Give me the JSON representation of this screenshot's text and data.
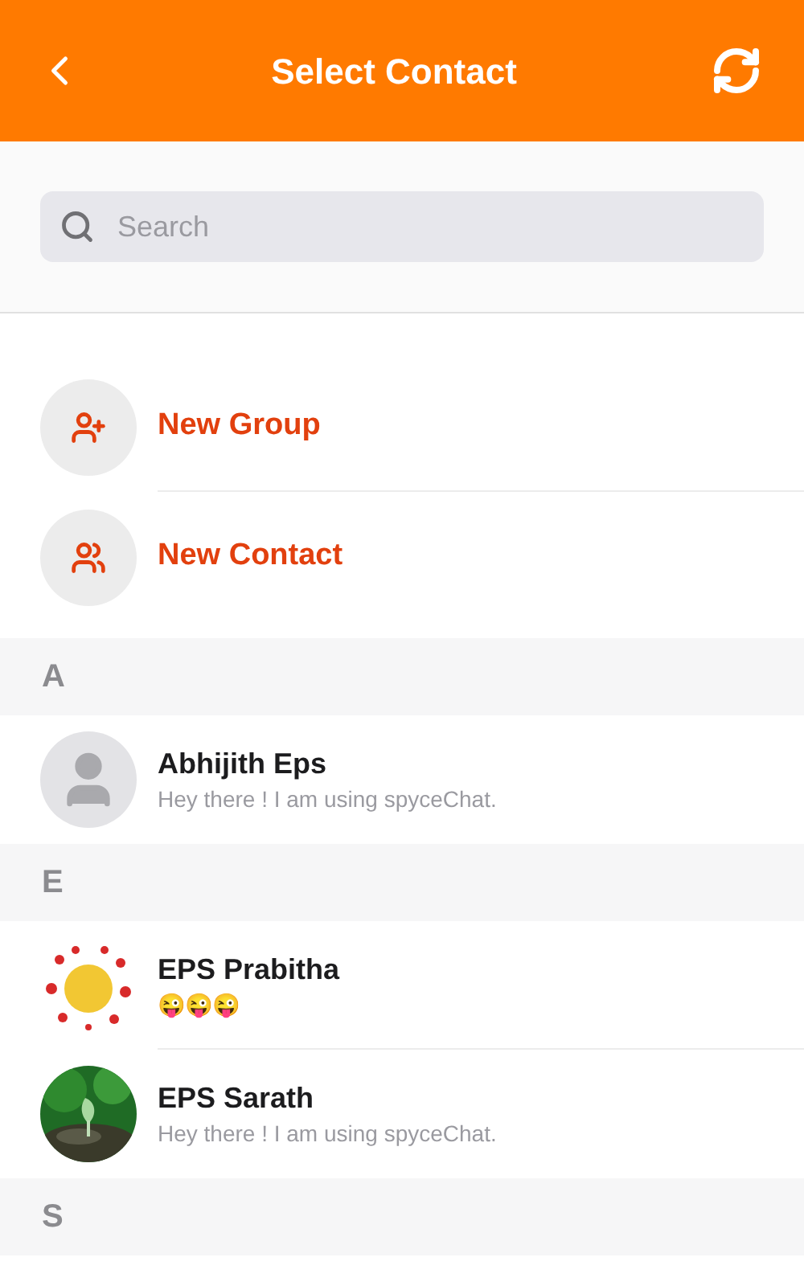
{
  "header": {
    "title": "Select Contact"
  },
  "search": {
    "placeholder": "Search"
  },
  "actions": [
    {
      "kind": "group",
      "label": "New Group"
    },
    {
      "kind": "contact",
      "label": "New Contact"
    }
  ],
  "sections": [
    {
      "letter": "A",
      "contacts": [
        {
          "name": "Abhijith Eps",
          "status": "Hey there ! I am using spyceChat.",
          "kind": "placeholder"
        }
      ]
    },
    {
      "letter": "E",
      "contacts": [
        {
          "name": "EPS Prabitha",
          "status": "😜😜😜",
          "kind": "picture"
        },
        {
          "name": "EPS Sarath",
          "status": "Hey there ! I am using spyceChat.",
          "kind": "picture"
        }
      ]
    },
    {
      "letter": "S"
    }
  ]
}
